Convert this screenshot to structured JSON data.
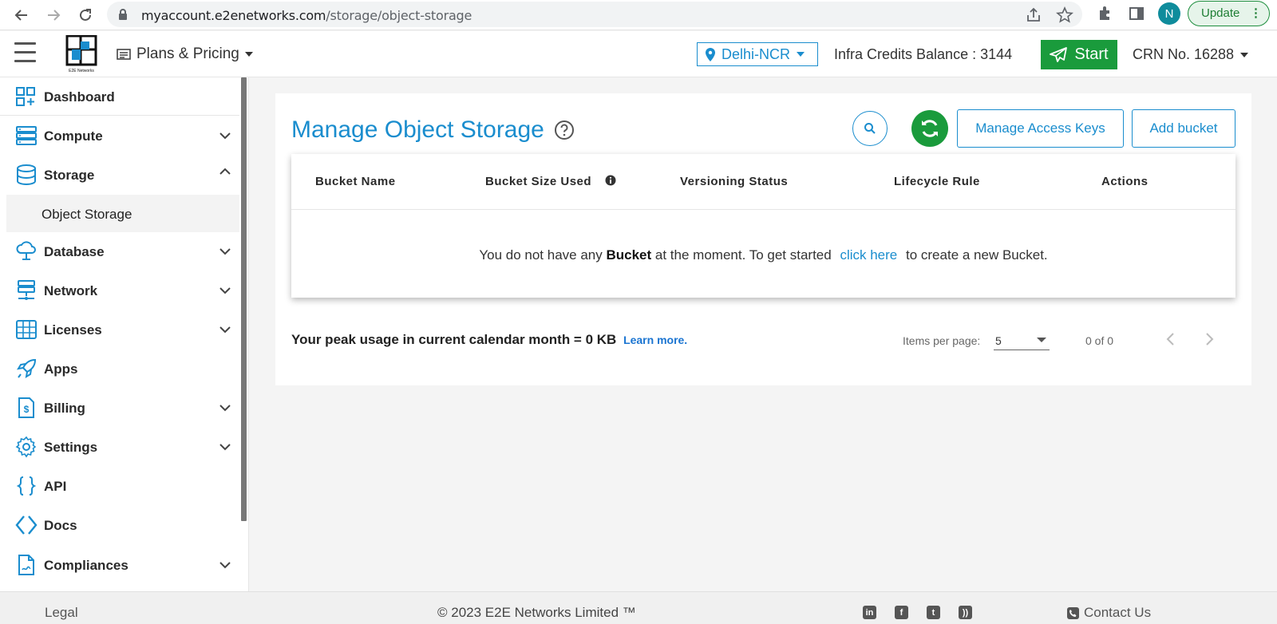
{
  "browser": {
    "url_host": "myaccount.e2enetworks.com",
    "url_path": "/storage/object-storage",
    "profile_initial": "N",
    "update_label": "Update"
  },
  "header": {
    "logo_text": "E2E Networks",
    "plans_label": "Plans & Pricing",
    "region_label": "Delhi-NCR",
    "credits_label": "Infra Credits Balance : 3144",
    "start_label": "Start",
    "crn_label": "CRN No. 16288"
  },
  "sidebar": {
    "items": [
      {
        "label": "Dashboard",
        "icon": "dashboard-icon",
        "expandable": false
      },
      {
        "label": "Compute",
        "icon": "server-icon",
        "expandable": true
      },
      {
        "label": "Storage",
        "icon": "database-icon",
        "expandable": true,
        "expanded": true
      },
      {
        "label": "Database",
        "icon": "cloud-db-icon",
        "expandable": true
      },
      {
        "label": "Network",
        "icon": "network-icon",
        "expandable": true
      },
      {
        "label": "Licenses",
        "icon": "licenses-icon",
        "expandable": true
      },
      {
        "label": "Apps",
        "icon": "rocket-icon",
        "expandable": false
      },
      {
        "label": "Billing",
        "icon": "billing-icon",
        "expandable": true
      },
      {
        "label": "Settings",
        "icon": "gear-icon",
        "expandable": true
      },
      {
        "label": "API",
        "icon": "braces-icon",
        "expandable": false
      },
      {
        "label": "Docs",
        "icon": "code-icon",
        "expandable": false
      },
      {
        "label": "Compliances",
        "icon": "document-icon",
        "expandable": true
      }
    ],
    "storage_sub": "Object Storage"
  },
  "main": {
    "title": "Manage Object Storage",
    "manage_keys_label": "Manage Access Keys",
    "add_bucket_label": "Add bucket",
    "table": {
      "headers": [
        "Bucket Name",
        "Bucket Size Used",
        "Versioning Status",
        "Lifecycle Rule",
        "Actions"
      ],
      "empty_pre": "You do not have any",
      "empty_bold": "Bucket",
      "empty_mid": "at the moment. To get started",
      "empty_link": "click here",
      "empty_post": "to create a new Bucket."
    },
    "usage_text": "Your peak usage in current calendar month = 0 KB",
    "learn_more": "Learn more.",
    "items_per_page_label": "Items per page:",
    "items_per_page_value": "5",
    "range_label": "0 of 0"
  },
  "footer": {
    "legal": "Legal",
    "copyright": "© 2023 E2E Networks Limited ™",
    "contact": "Contact Us"
  },
  "colors": {
    "accent_blue": "#1a8dce",
    "accent_green": "#1a9b3c"
  }
}
